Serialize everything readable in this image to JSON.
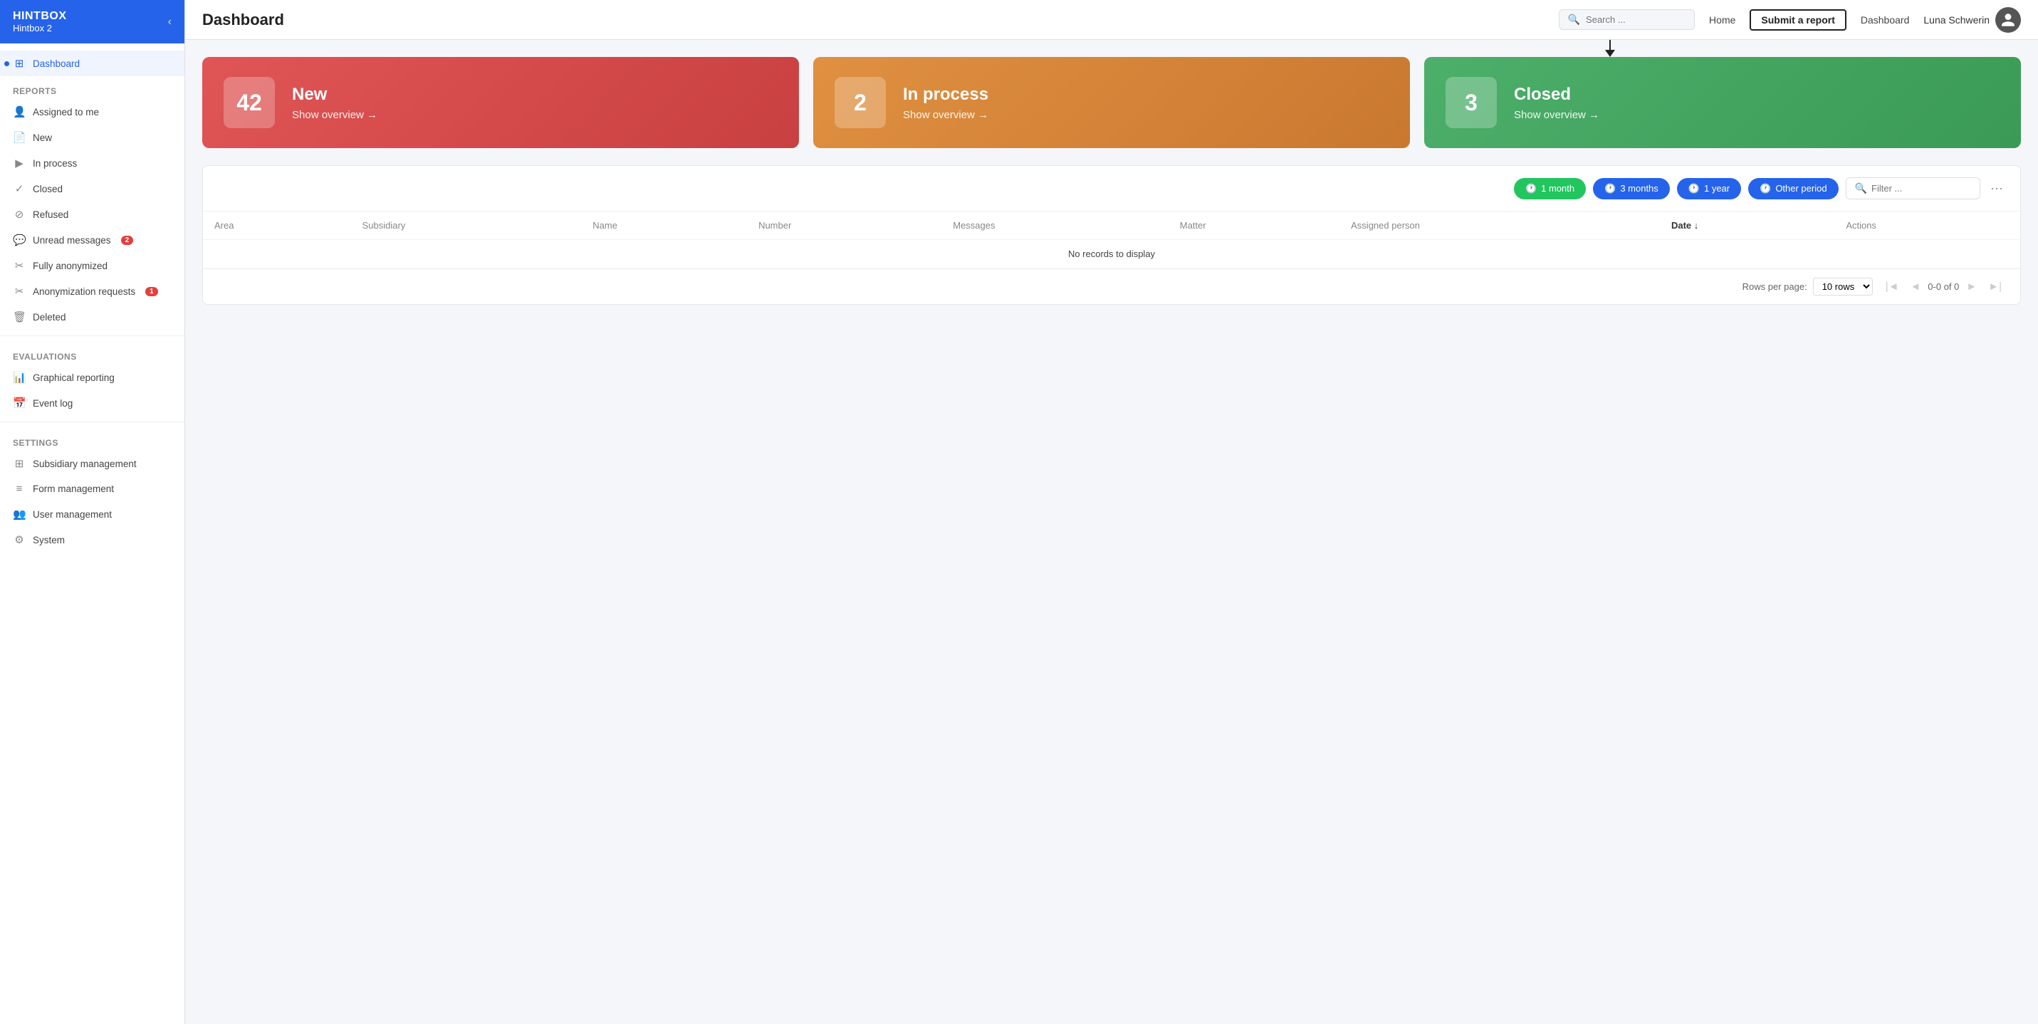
{
  "brand": {
    "title": "HINTBOX",
    "subtitle": "Hintbox 2",
    "chevron": "‹"
  },
  "sidebar": {
    "active_item": "dashboard",
    "nav_active_label": "Dashboard",
    "reports_section": "Reports",
    "evaluations_section": "Evaluations",
    "settings_section": "Settings",
    "items": [
      {
        "id": "dashboard",
        "label": "Dashboard",
        "icon": "⊞",
        "active": true
      },
      {
        "id": "assigned-to-me",
        "label": "Assigned to me",
        "icon": "👤",
        "active": false
      },
      {
        "id": "new",
        "label": "New",
        "icon": "📄",
        "active": false
      },
      {
        "id": "in-process",
        "label": "In process",
        "icon": "▶",
        "active": false
      },
      {
        "id": "closed",
        "label": "Closed",
        "icon": "✓",
        "active": false
      },
      {
        "id": "refused",
        "label": "Refused",
        "icon": "⊘",
        "active": false
      },
      {
        "id": "unread-messages",
        "label": "Unread messages",
        "icon": "💬",
        "active": false,
        "badge": "2"
      },
      {
        "id": "fully-anonymized",
        "label": "Fully anonymized",
        "icon": "✂",
        "active": false
      },
      {
        "id": "anonymization-requests",
        "label": "Anonymization requests",
        "icon": "✂",
        "active": false,
        "badge": "1"
      },
      {
        "id": "deleted",
        "label": "Deleted",
        "icon": "🗑",
        "active": false
      }
    ],
    "evaluations_items": [
      {
        "id": "graphical-reporting",
        "label": "Graphical reporting",
        "icon": "📊"
      },
      {
        "id": "event-log",
        "label": "Event log",
        "icon": "📅"
      }
    ],
    "settings_items": [
      {
        "id": "subsidiary-management",
        "label": "Subsidiary management",
        "icon": "⊞"
      },
      {
        "id": "form-management",
        "label": "Form management",
        "icon": "≡"
      },
      {
        "id": "user-management",
        "label": "User management",
        "icon": "👥"
      },
      {
        "id": "system",
        "label": "System",
        "icon": "⚙"
      }
    ]
  },
  "header": {
    "title": "Dashboard",
    "search_placeholder": "Search ...",
    "nav_links": [
      "Home",
      "Submit a report",
      "Dashboard"
    ],
    "submit_report_label": "Submit a report",
    "home_label": "Home",
    "dashboard_label": "Dashboard",
    "user_name": "Luna Schwerin"
  },
  "stat_cards": [
    {
      "id": "new",
      "number": "42",
      "label": "New",
      "link_text": "Show overview  →",
      "color": "new"
    },
    {
      "id": "in-process",
      "number": "2",
      "label": "In process",
      "link_text": "Show overview  →",
      "color": "inprocess"
    },
    {
      "id": "closed",
      "number": "3",
      "label": "Closed",
      "link_text": "Show overview  →",
      "color": "closed"
    }
  ],
  "table": {
    "toolbar": {
      "period_buttons": [
        {
          "id": "1month",
          "label": "1 month",
          "active": true
        },
        {
          "id": "3months",
          "label": "3 months",
          "active": false
        },
        {
          "id": "1year",
          "label": "1 year",
          "active": false
        },
        {
          "id": "other-period",
          "label": "Other period",
          "active": false
        }
      ],
      "filter_placeholder": "Filter ..."
    },
    "columns": [
      {
        "id": "area",
        "label": "Area"
      },
      {
        "id": "subsidiary",
        "label": "Subsidiary"
      },
      {
        "id": "name",
        "label": "Name"
      },
      {
        "id": "number",
        "label": "Number"
      },
      {
        "id": "messages",
        "label": "Messages"
      },
      {
        "id": "matter",
        "label": "Matter"
      },
      {
        "id": "assigned-person",
        "label": "Assigned person"
      },
      {
        "id": "date",
        "label": "Date ↓",
        "sorted": true
      },
      {
        "id": "actions",
        "label": "Actions"
      }
    ],
    "rows": [],
    "no_records_text": "No records to display",
    "footer": {
      "rows_per_page_label": "Rows per page:",
      "rows_per_page_value": "10 rows",
      "pagination_info": "0-0 of 0"
    }
  }
}
